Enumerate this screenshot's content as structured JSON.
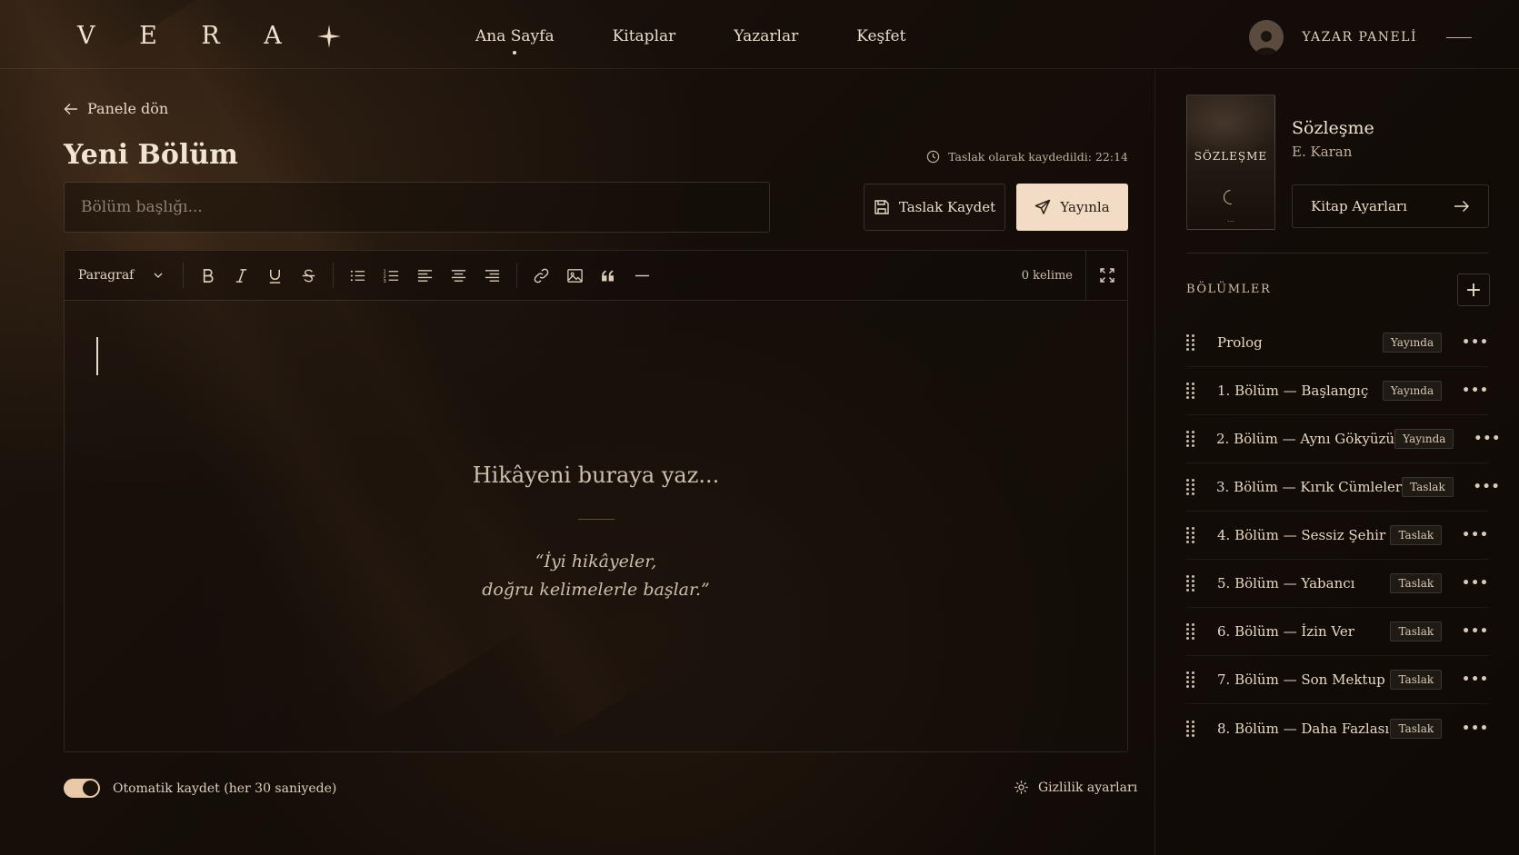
{
  "logo": {
    "text": "V E R A"
  },
  "nav": [
    {
      "label": "Ana Sayfa",
      "active": true
    },
    {
      "label": "Kitaplar"
    },
    {
      "label": "Yazarlar"
    },
    {
      "label": "Keşfet"
    }
  ],
  "user": {
    "label": "YAZAR PANELİ"
  },
  "back_link": "Panele dön",
  "page_title": "Yeni Bölüm",
  "saved_status": "Taslak olarak kaydedildi: 22:14",
  "chapter_title_placeholder": "Bölüm başlığı...",
  "buttons": {
    "save_draft": "Taslak Kaydet",
    "publish": "Yayınla"
  },
  "toolbar": {
    "block_type": "Paragraf",
    "word_count": "0 kelime"
  },
  "editor": {
    "placeholder": "Hikâyeni buraya yaz...",
    "quote_line1": "“İyi hikâyeler,",
    "quote_line2": "doğru kelimelerle başlar.”"
  },
  "footer": {
    "autosave_label": "Otomatik kaydet (her 30 saniyede)",
    "autosave_on": true,
    "privacy_label": "Gizlilik ayarları"
  },
  "book": {
    "cover_title": "SÖZLEŞME",
    "cover_dots": "...",
    "title": "Sözleşme",
    "author": "E. Karan",
    "settings_label": "Kitap Ayarları"
  },
  "chapters": {
    "heading": "BÖLÜMLER",
    "items": [
      {
        "name": "Prolog",
        "status": "Yayında"
      },
      {
        "name": "1. Bölüm — Başlangıç",
        "status": "Yayında"
      },
      {
        "name": "2. Bölüm — Aynı Gökyüzü",
        "status": "Yayında"
      },
      {
        "name": "3. Bölüm — Kırık Cümleler",
        "status": "Taslak"
      },
      {
        "name": "4. Bölüm — Sessiz Şehir",
        "status": "Taslak"
      },
      {
        "name": "5. Bölüm — Yabancı",
        "status": "Taslak"
      },
      {
        "name": "6. Bölüm — İzin Ver",
        "status": "Taslak"
      },
      {
        "name": "7. Bölüm — Son Mektup",
        "status": "Taslak"
      },
      {
        "name": "8. Bölüm — Daha Fazlası",
        "status": "Taslak"
      }
    ]
  },
  "colors": {
    "accent": "#f3dcc6",
    "background": "#140d08",
    "text": "#e9dccb"
  }
}
